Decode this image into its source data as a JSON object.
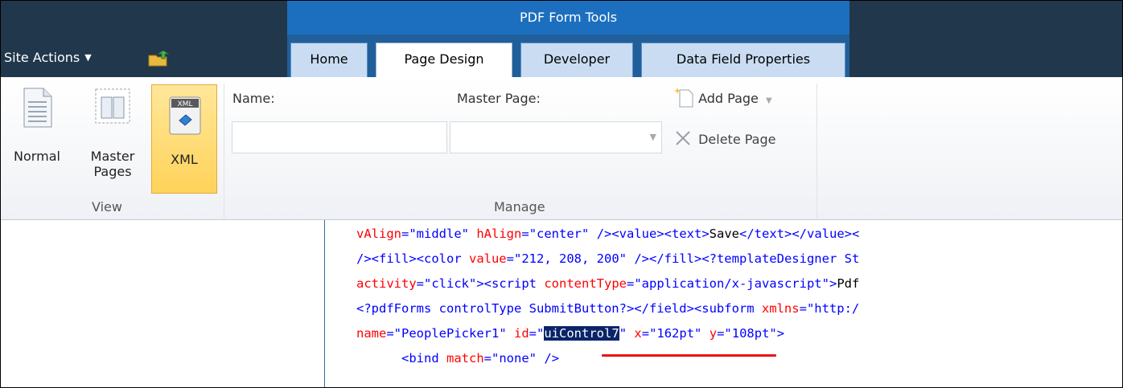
{
  "topbar": {
    "site_actions": "Site Actions",
    "ctx_title": "PDF Form Tools",
    "tabs": [
      {
        "label": "Home"
      },
      {
        "label": "Page Design"
      },
      {
        "label": "Developer"
      },
      {
        "label": "Data Field Properties"
      }
    ],
    "icons": {
      "navigate_up": "folder-up-icon",
      "dropdown": "chevron-down-icon"
    }
  },
  "ribbon": {
    "view": {
      "label": "View",
      "buttons": [
        {
          "label": "Normal",
          "icon": "page-icon"
        },
        {
          "label_line1": "Master",
          "label_line2": "Pages",
          "icon": "master-pages-icon"
        },
        {
          "label": "XML",
          "icon": "xml-icon",
          "badge": "XML"
        }
      ]
    },
    "manage": {
      "label": "Manage",
      "name_label": "Name:",
      "name_value": "",
      "master_label": "Master Page:",
      "master_value": "",
      "add_page": "Add Page",
      "delete_page": "Delete Page"
    }
  },
  "code": {
    "lines": [
      [
        [
          "a",
          "vAlign"
        ],
        [
          "t",
          "="
        ],
        [
          "v",
          "\"middle\""
        ],
        [
          "txt",
          " "
        ],
        [
          "a",
          "hAlign"
        ],
        [
          "t",
          "="
        ],
        [
          "v",
          "\"center\""
        ],
        [
          "txt",
          " "
        ],
        [
          "t",
          "/><value><text>"
        ],
        [
          "txt",
          "Save"
        ],
        [
          "t",
          "</text></value><"
        ]
      ],
      [
        [
          "t",
          "/><fill><color "
        ],
        [
          "a",
          "value"
        ],
        [
          "t",
          "="
        ],
        [
          "v",
          "\"212, 208, 200\""
        ],
        [
          "txt",
          " "
        ],
        [
          "t",
          "/></fill><?templateDesigner St"
        ]
      ],
      [
        [
          "a",
          "activity"
        ],
        [
          "t",
          "="
        ],
        [
          "v",
          "\"click\""
        ],
        [
          "t",
          "><script "
        ],
        [
          "a",
          "contentType"
        ],
        [
          "t",
          "="
        ],
        [
          "v",
          "\"application/x-javascript\""
        ],
        [
          "t",
          ">"
        ],
        [
          "txt",
          "Pdf"
        ]
      ],
      [
        [
          "t",
          "<?pdfForms controlType SubmitButton?></field><subform "
        ],
        [
          "a",
          "xmlns"
        ],
        [
          "t",
          "="
        ],
        [
          "v",
          "\"http:/"
        ]
      ],
      [
        [
          "a",
          "name"
        ],
        [
          "t",
          "="
        ],
        [
          "v",
          "\"PeoplePicker1\""
        ],
        [
          "txt",
          " "
        ],
        [
          "a",
          "id"
        ],
        [
          "t",
          "="
        ],
        [
          "v",
          "\""
        ],
        [
          "sel",
          "uiControl7"
        ],
        [
          "v",
          "\""
        ],
        [
          "txt",
          " "
        ],
        [
          "a",
          "x"
        ],
        [
          "t",
          "="
        ],
        [
          "v",
          "\"162pt\""
        ],
        [
          "txt",
          " "
        ],
        [
          "a",
          "y"
        ],
        [
          "t",
          "="
        ],
        [
          "v",
          "\"108pt\""
        ],
        [
          "t",
          ">"
        ]
      ],
      [
        [
          "txt",
          "      "
        ],
        [
          "t",
          "<bind "
        ],
        [
          "a",
          "match"
        ],
        [
          "t",
          "="
        ],
        [
          "v",
          "\"none\""
        ],
        [
          "txt",
          " "
        ],
        [
          "t",
          "/>"
        ]
      ]
    ]
  }
}
